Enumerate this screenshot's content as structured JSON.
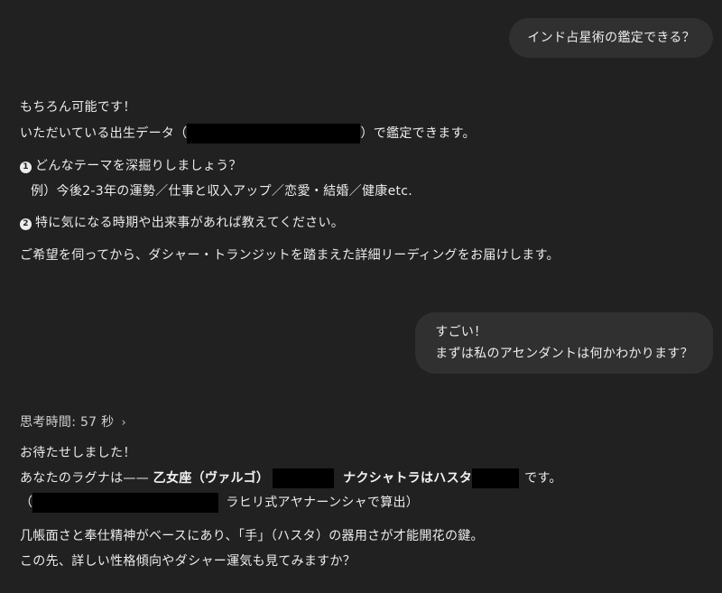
{
  "messages": {
    "user_1": "インド占星術の鑑定できる？",
    "assistant_1": {
      "line1": "もちろん可能です！",
      "line2_pre": "いただいている出生データ（",
      "line2_post": "）で鑑定できます。",
      "item1_num": "1",
      "item1_text": "どんなテーマを深掘りしましょう？",
      "item1_example": "例）今後2-3年の運勢／仕事と収入アップ／恋愛・結婚／健康etc.",
      "item2_num": "2",
      "item2_text": "特に気になる時期や出来事があれば教えてください。",
      "closing": "ご希望を伺ってから、ダシャー・トランジットを踏まえた詳細リーディングをお届けします。"
    },
    "user_2": {
      "line1": "すごい！",
      "line2": "まずは私のアセンダントは何かわかります？"
    },
    "assistant_2": {
      "thinking_label": "思考時間: 57 秒",
      "line1": "お待たせしました！",
      "line2_pre": "あなたのラグナは—— ",
      "line2_bold1": "乙女座（ヴァルゴ）",
      "line2_bold2": "ナクシャトラはハスタ",
      "line2_post": "です。",
      "line3_open": "（",
      "line3_text": "ラヒリ式アヤナーンシャで算出）",
      "line4": "几帳面さと奉仕精神がベースにあり、「手」（ハスタ）の器用さが才能開花の鍵。",
      "line5": "この先、詳しい性格傾向やダシャー運気も見てみますか？"
    }
  },
  "icons": {
    "chevron": "chevron-right-icon"
  },
  "colors": {
    "background": "#212121",
    "bubble": "#303030",
    "text": "#ececec",
    "redaction": "#000000"
  }
}
